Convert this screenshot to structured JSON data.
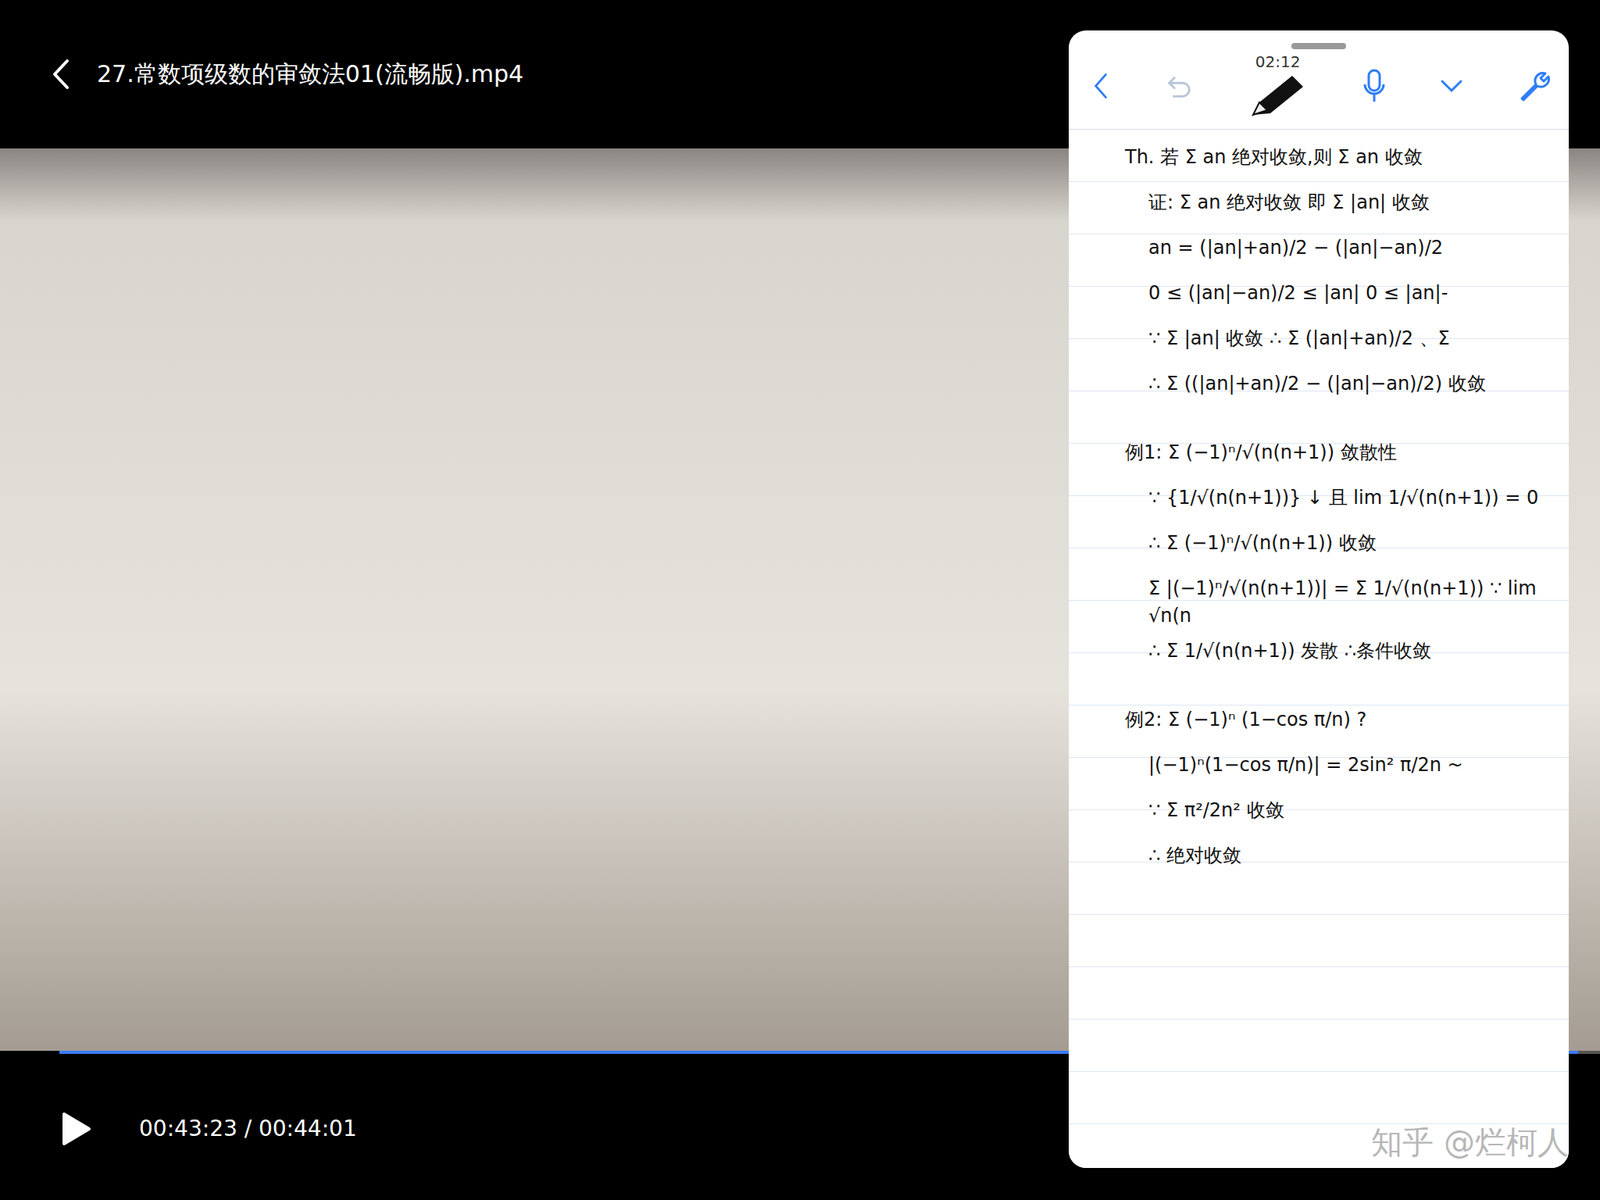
{
  "player": {
    "title": "27.常数项级数的审敛法01(流畅版).mp4",
    "time": "00:43:23 / 00:44:01",
    "playing": false,
    "progress": {
      "level": 0.986
    }
  },
  "notes": {
    "clock": "02:12",
    "undo": {
      "disabled": true
    },
    "sections": [
      {
        "lines": [
          "Th. 若 Σ an 绝对收敛,则 Σ an 收敛",
          "证: Σ an 绝对收敛 即 Σ |an| 收敛",
          "an = (|an|+an)/2 − (|an|−an)/2",
          "0 ≤ (|an|−an)/2 ≤ |an|     0 ≤ |an|-",
          "∵ Σ |an| 收敛 ∴ Σ (|an|+an)/2 、Σ",
          "∴ Σ ((|an|+an)/2 − (|an|−an)/2) 收敛"
        ]
      },
      {
        "lines": [
          "例1: Σ (−1)ⁿ/√(n(n+1)) 敛散性",
          "∵ {1/√(n(n+1))} ↓ 且 lim 1/√(n(n+1)) = 0",
          "∴ Σ (−1)ⁿ/√(n(n+1)) 收敛",
          "Σ |(−1)ⁿ/√(n(n+1))| = Σ 1/√(n(n+1))  ∵ lim √n(n",
          "∴ Σ 1/√(n(n+1)) 发散   ∴条件收敛"
        ]
      },
      {
        "lines": [
          "例2: Σ (−1)ⁿ (1−cos π/n) ?",
          "|(−1)ⁿ(1−cos π/n)| = 2sin² π/2n ~",
          "∵ Σ π²/2n² 收敛",
          "∴ 绝对收敛"
        ]
      }
    ],
    "watermark": "知乎 @烂柯人"
  }
}
